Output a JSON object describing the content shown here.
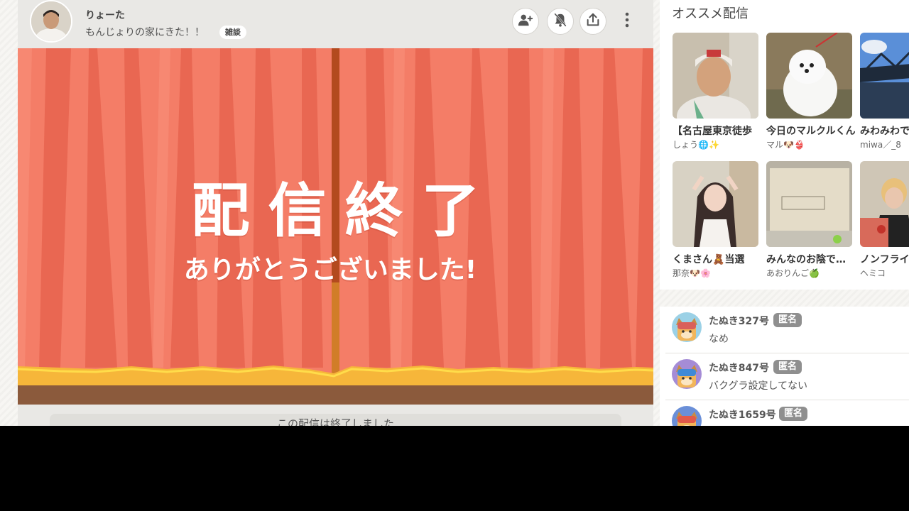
{
  "streamer": {
    "name": "りょーた",
    "title": "もんじょりの家にきた！！",
    "category": "雑談"
  },
  "header_buttons": [
    "user-plus-icon",
    "bell-off-icon",
    "share-icon",
    "more-vertical-icon"
  ],
  "player": {
    "end_title": "配信終了",
    "end_subtitle": "ありがとうございました!",
    "ended_message": "この配信は終了しました"
  },
  "recommendations": {
    "heading": "オススメ配信",
    "items": [
      {
        "title": "【名古屋東京徒歩",
        "user": "しょう🌐✨"
      },
      {
        "title": "今日のマルクルくん",
        "user": "マル🐶👙"
      },
      {
        "title": "みわみわで",
        "user": "miwa／_8"
      },
      {
        "title": "くまさん🧸当選",
        "user": "那奈🐶🌸"
      },
      {
        "title": "みんなのお陰で…",
        "user": "あおりんご🍏"
      },
      {
        "title": "ノンフライ",
        "user": "ヘミコ"
      }
    ]
  },
  "comments": [
    {
      "name": "たぬき327号",
      "badge": "匿名",
      "text": "なめ"
    },
    {
      "name": "たぬき847号",
      "badge": "匿名",
      "text": "バクグラ設定してない"
    },
    {
      "name": "たぬき1659号",
      "badge": "匿名",
      "text": ""
    }
  ],
  "colors": {
    "curtain": "#f47d67",
    "curtain_dark": "#e8644f",
    "stage_gold": "#f6b63a",
    "stage_floor": "#8b5a3c",
    "badge_gray": "#8f8f8f"
  }
}
